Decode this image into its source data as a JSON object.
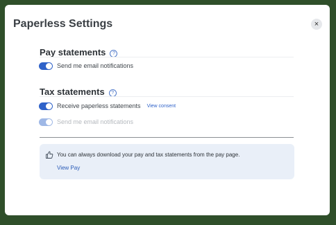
{
  "modal": {
    "title": "Paperless Settings",
    "close_label": "×"
  },
  "pay_statements": {
    "title": "Pay statements",
    "email_notifications": {
      "label": "Send me email notifications",
      "checked": true
    }
  },
  "tax_statements": {
    "title": "Tax statements",
    "paperless": {
      "label": "Receive paperless statements",
      "checked": true
    },
    "consent_link": "View consent",
    "email_notifications": {
      "label": "Send me email notifications",
      "checked": true,
      "disabled": true
    }
  },
  "info": {
    "text": "You can always download your pay and tax statements from the pay page.",
    "link": "View Pay"
  },
  "colors": {
    "frame": "#2f4f2a",
    "accent": "#2f62c9",
    "info_bg": "#e9eff8"
  }
}
